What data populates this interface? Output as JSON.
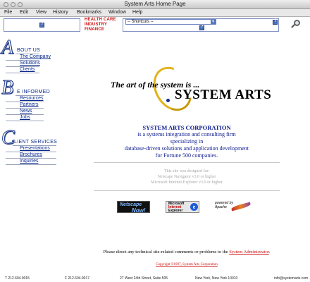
{
  "window": {
    "title": "System Arts Home Page"
  },
  "menu": [
    "File",
    "Edit",
    "View",
    "History",
    "Bookmarks",
    "Window",
    "Help"
  ],
  "top": {
    "industry_lines": [
      "HEALTH CARE",
      "INDUSTRY",
      "FINANCE"
    ],
    "shortcuts_selected": "-- Shortcuts --",
    "icons": [
      "help-icon",
      "help-icon",
      "magnifier-icon"
    ]
  },
  "nav": [
    {
      "letter": "A",
      "title": "BOUT US",
      "links": [
        "The Company",
        "Solutions",
        "Clients"
      ]
    },
    {
      "letter": "B",
      "title": "E INFORMED",
      "links": [
        "Resources",
        "Partners",
        "News",
        "Jobs"
      ]
    },
    {
      "letter": "C",
      "title": "LIENT SERVICES",
      "links": [
        "Presentations",
        "Brochures",
        "Inquiries"
      ]
    }
  ],
  "logo": {
    "tagline": "The art of the system is ...",
    "brand": "SYSTEM ARTS"
  },
  "intro": {
    "company": "SYSTEM ARTS CORPORATION",
    "lines": [
      "is a systems integration and consulting firm",
      "specializing in",
      "database-driven solutions and application development",
      "for Fortune 500 companies."
    ]
  },
  "designed_for": {
    "heading": "This site was designed for:",
    "lines": [
      "Netscape Navigator v3.0 or higher",
      "Microsoft Internet Explorer v3.0 or higher"
    ]
  },
  "badges": {
    "netscape": [
      "Netscape",
      "Now!"
    ],
    "ie": [
      "Microsoft",
      "Internet",
      "Explorer"
    ],
    "apache": [
      "powered by",
      "Apache"
    ]
  },
  "contact": {
    "prefix": "Please direct any technical site-related comments or problems to the",
    "link": "System Administrator",
    "suffix": "."
  },
  "copyright": "Copyright ©1997, System Arts Corporation",
  "footer": {
    "phone": "T 212.604.9015",
    "fax": "F 212.604.9017",
    "address": "27 West 24th Street, Suite 505",
    "city": "New York, New York 10010",
    "email": "info@systemarts.com"
  },
  "colors": {
    "nav_blue": "#0a2a8c",
    "accent_red": "#cc1111",
    "logo_gold": "#e0b318"
  }
}
